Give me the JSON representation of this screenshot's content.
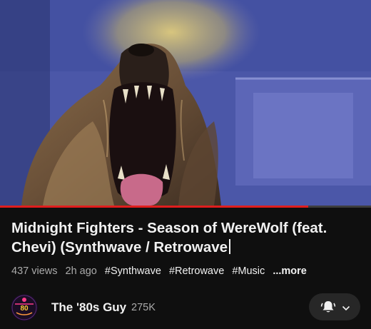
{
  "video": {
    "progress_fraction": 0.83
  },
  "title": {
    "line1": "Midnight Fighters - Season of WereWolf (feat.",
    "line2": "Chevi) (Synthwave / Retrowave"
  },
  "meta": {
    "views": "437 views",
    "age": "2h ago",
    "tags": [
      "#Synthwave",
      "#Retrowave",
      "#Music"
    ],
    "more": "...more"
  },
  "channel": {
    "name": "The '80s Guy",
    "subscribers": "275K",
    "avatar_text": "80"
  },
  "subscribe_button": {
    "icon": "bell-icon",
    "dropdown_icon": "chevron-down-icon"
  },
  "colors": {
    "progress": "#e01d1d",
    "background": "#0f0f0f",
    "button_bg": "#272727"
  }
}
